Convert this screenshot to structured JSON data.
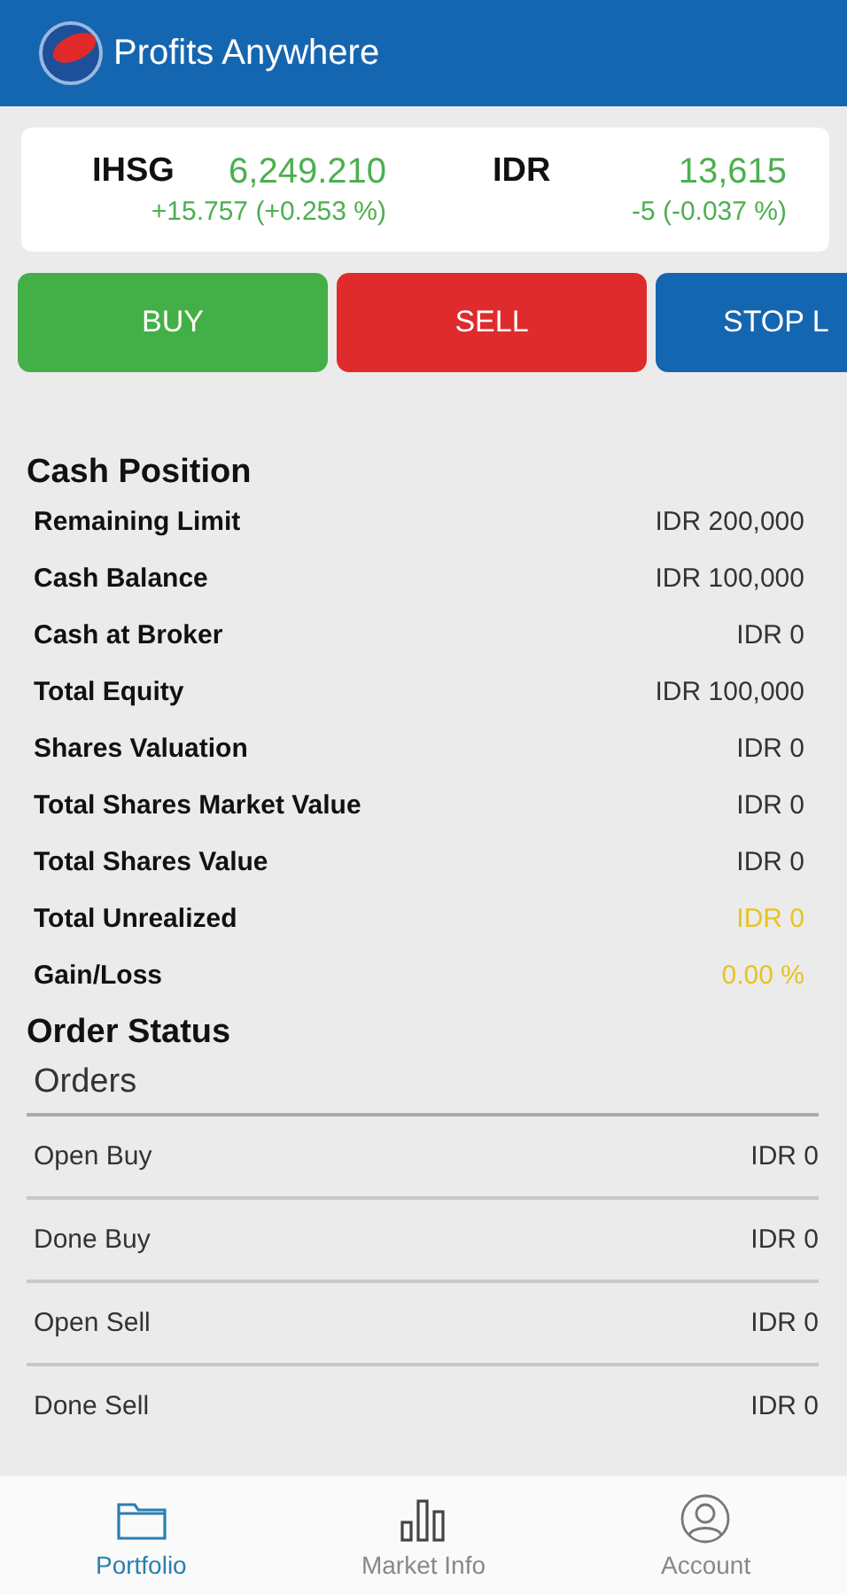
{
  "app_bar": {
    "title": "Profits Anywhere"
  },
  "tickers": [
    {
      "symbol": "IHSG",
      "value": "6,249.210",
      "change": "+15.757 (+0.253 %)"
    },
    {
      "symbol": "IDR",
      "value": "13,615",
      "change": "-5 (-0.037 %)"
    }
  ],
  "actions": [
    {
      "label": "BUY",
      "kind": "buy"
    },
    {
      "label": "SELL",
      "kind": "sell"
    },
    {
      "label": "STOP L",
      "kind": "stop"
    }
  ],
  "cash_position": {
    "title": "Cash Position",
    "rows": [
      {
        "label": "Remaining Limit",
        "value": "IDR 200,000",
        "highlight": false
      },
      {
        "label": "Cash Balance",
        "value": "IDR 100,000",
        "highlight": false
      },
      {
        "label": "Cash at Broker",
        "value": "IDR 0",
        "highlight": false
      },
      {
        "label": "Total Equity",
        "value": "IDR 100,000",
        "highlight": false
      },
      {
        "label": "Shares Valuation",
        "value": "IDR 0",
        "highlight": false
      },
      {
        "label": "Total Shares Market Value",
        "value": "IDR 0",
        "highlight": false
      },
      {
        "label": "Total Shares Value",
        "value": "IDR 0",
        "highlight": false
      },
      {
        "label": "Total Unrealized",
        "value": "IDR 0",
        "highlight": true
      },
      {
        "label": "Gain/Loss",
        "value": "0.00 %",
        "highlight": true
      }
    ]
  },
  "order_status": {
    "title": "Order Status",
    "subtitle": "Orders",
    "rows": [
      {
        "label": "Open Buy",
        "value": "IDR 0"
      },
      {
        "label": "Done Buy",
        "value": "IDR 0"
      },
      {
        "label": "Open Sell",
        "value": "IDR 0"
      },
      {
        "label": "Done Sell",
        "value": "IDR 0"
      }
    ]
  },
  "tabs": [
    {
      "label": "Portfolio",
      "kind": "folder",
      "selected": true
    },
    {
      "label": "Market Info",
      "kind": "bars",
      "selected": false
    },
    {
      "label": "Account",
      "kind": "person",
      "selected": false
    }
  ]
}
